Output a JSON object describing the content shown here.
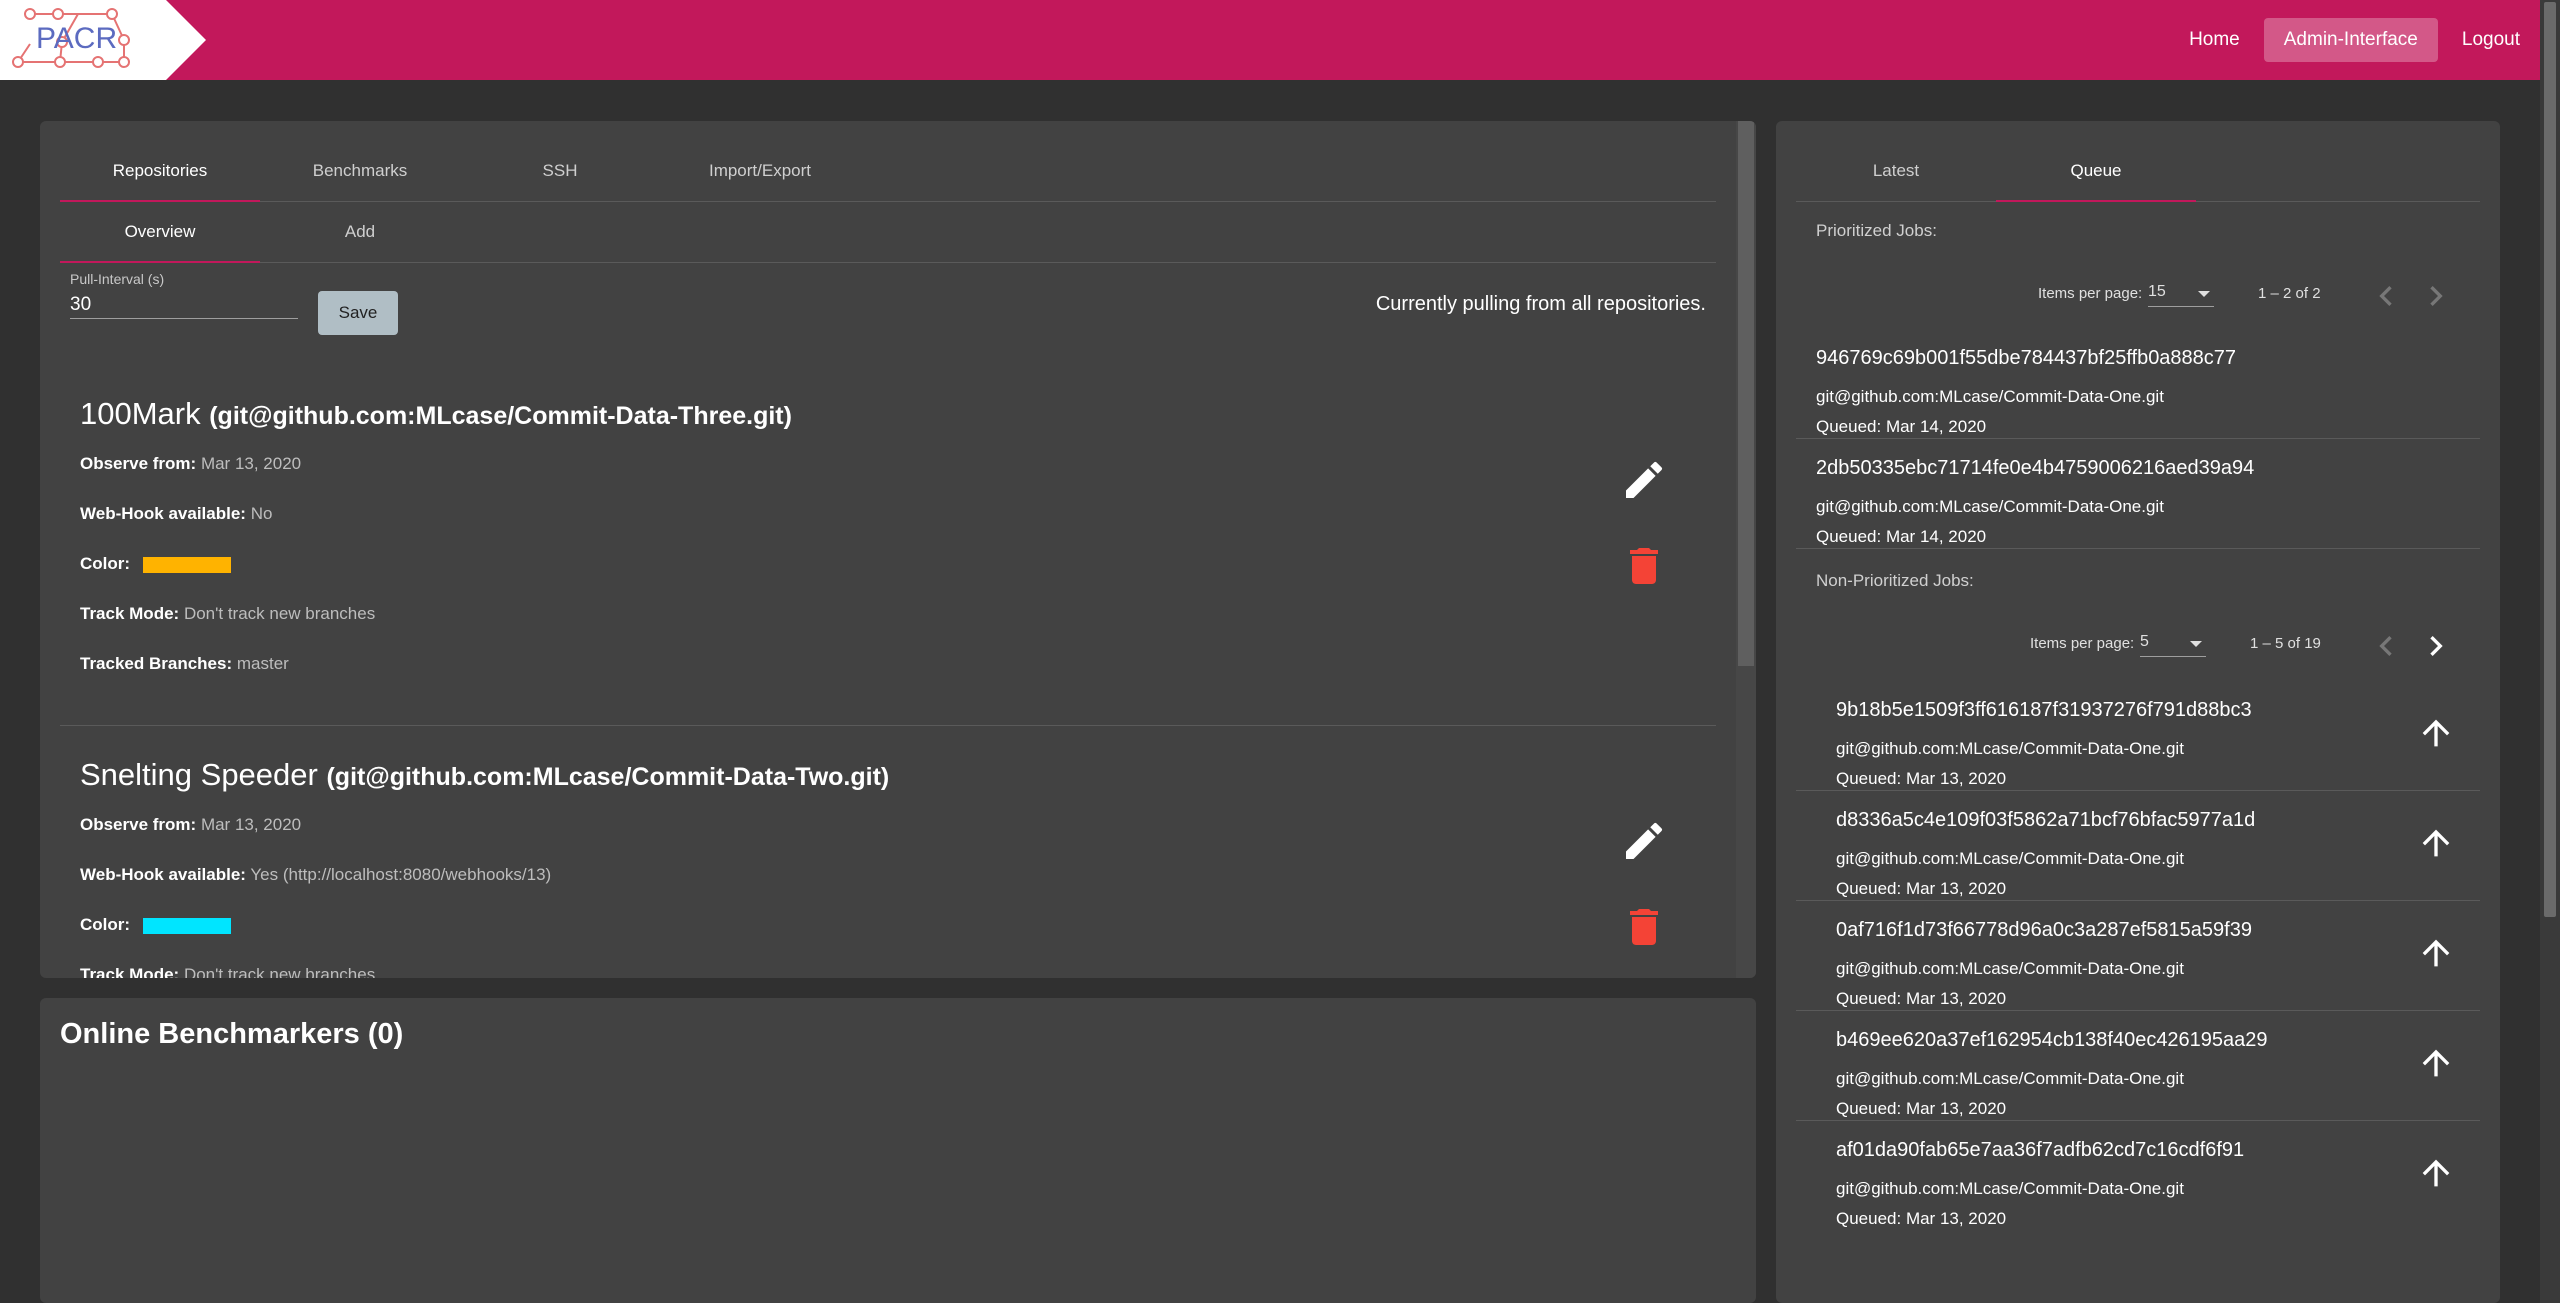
{
  "header": {
    "logo_text": "PACR",
    "nav": [
      "Home",
      "Admin-Interface",
      "Logout"
    ],
    "brand_color": "#c2185b"
  },
  "admin": {
    "tabs": [
      "Repositories",
      "Benchmarks",
      "SSH",
      "Import/Export"
    ],
    "active_tab": "Repositories",
    "subtabs": [
      "Overview",
      "Add"
    ],
    "active_subtab": "Overview",
    "pull_interval_label": "Pull-Interval (s)",
    "pull_interval_value": "30",
    "save_label": "Save",
    "pull_status": "Currently pulling from all repositories.",
    "repos": [
      {
        "name": "100Mark",
        "url": "(git@github.com:MLcase/Commit-Data-Three.git)",
        "observe_label": "Observe from:",
        "observe_value": "Mar 13, 2020",
        "webhook_label": "Web-Hook available:",
        "webhook_value": "No",
        "color_label": "Color:",
        "color": "#ffb300",
        "track_label": "Track Mode:",
        "track_value": "Don't track new branches",
        "branches_label": "Tracked Branches:",
        "branches_value": "master",
        "edit_icon": "pencil-icon",
        "delete_icon": "trash-icon"
      },
      {
        "name": "Snelting Speeder",
        "url": "(git@github.com:MLcase/Commit-Data-Two.git)",
        "observe_label": "Observe from:",
        "observe_value": "Mar 13, 2020",
        "webhook_label": "Web-Hook available:",
        "webhook_value": "Yes (http://localhost:8080/webhooks/13)",
        "color_label": "Color:",
        "color": "#00e5ff",
        "track_label": "Track Mode:",
        "track_value": "Don't track new branches",
        "edit_icon": "pencil-icon",
        "delete_icon": "trash-icon"
      }
    ]
  },
  "benchmarkers": {
    "title": "Online Benchmarkers (0)"
  },
  "queue": {
    "tabs": [
      "Latest",
      "Queue"
    ],
    "active_tab": "Queue",
    "prioritized_label": "Prioritized Jobs:",
    "prioritized_paginator": {
      "items_label": "Items per page:",
      "per_page": "15",
      "range": "1 – 2 of 2"
    },
    "prioritized_jobs": [
      {
        "hash": "946769c69b001f55dbe784437bf25ffb0a888c77",
        "repo": "git@github.com:MLcase/Commit-Data-One.git",
        "queued": "Queued: Mar 14, 2020"
      },
      {
        "hash": "2db50335ebc71714fe0e4b4759006216aed39a94",
        "repo": "git@github.com:MLcase/Commit-Data-One.git",
        "queued": "Queued: Mar 14, 2020"
      }
    ],
    "non_prioritized_label": "Non-Prioritized Jobs:",
    "non_prioritized_paginator": {
      "items_label": "Items per page:",
      "per_page": "5",
      "range": "1 – 5 of 19"
    },
    "non_prioritized_jobs": [
      {
        "hash": "9b18b5e1509f3ff616187f31937276f791d88bc3",
        "repo": "git@github.com:MLcase/Commit-Data-One.git",
        "queued": "Queued: Mar 13, 2020"
      },
      {
        "hash": "d8336a5c4e109f03f5862a71bcf76bfac5977a1d",
        "repo": "git@github.com:MLcase/Commit-Data-One.git",
        "queued": "Queued: Mar 13, 2020"
      },
      {
        "hash": "0af716f1d73f66778d96a0c3a287ef5815a59f39",
        "repo": "git@github.com:MLcase/Commit-Data-One.git",
        "queued": "Queued: Mar 13, 2020"
      },
      {
        "hash": "b469ee620a37ef162954cb138f40ec426195aa29",
        "repo": "git@github.com:MLcase/Commit-Data-One.git",
        "queued": "Queued: Mar 13, 2020"
      },
      {
        "hash": "af01da90fab65e7aa36f7adfb62cd7c16cdf6f91",
        "repo": "git@github.com:MLcase/Commit-Data-One.git",
        "queued": "Queued: Mar 13, 2020"
      }
    ]
  }
}
